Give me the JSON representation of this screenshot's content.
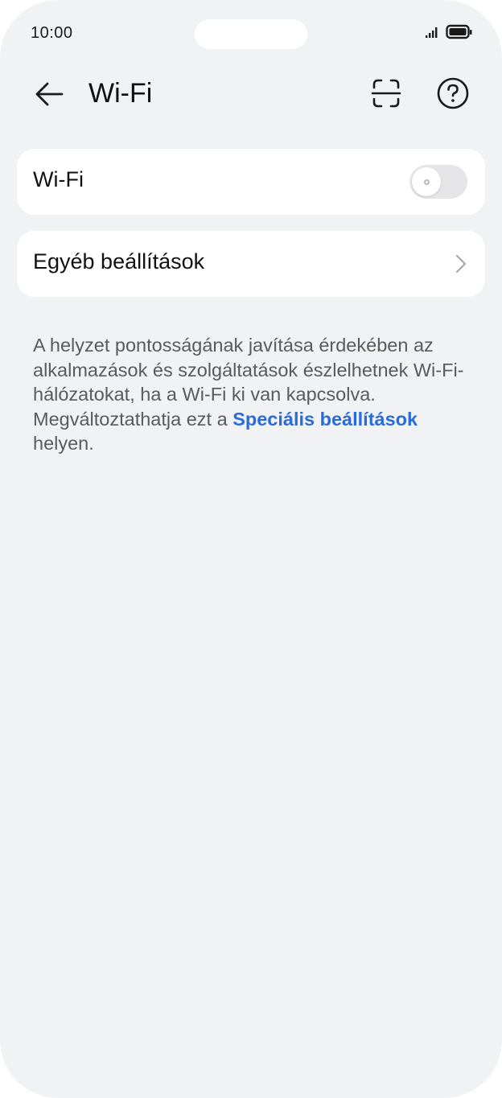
{
  "status_bar": {
    "time": "10:00",
    "icons": [
      "signal-icon",
      "battery-icon"
    ]
  },
  "header": {
    "title": "Wi-Fi",
    "back_icon": "back-arrow-icon",
    "scan_icon": "scan-qr-icon",
    "help_icon": "help-icon"
  },
  "settings": {
    "wifi": {
      "label": "Wi-Fi",
      "enabled": false
    },
    "other": {
      "label": "Egyéb beállítások",
      "icon": "chevron-right-icon"
    }
  },
  "info": {
    "text_before": "A helyzet pontosságának javítása érdekében az alkalmazások és szolgáltatások észlelhetnek Wi-Fi-hálózatokat, ha a Wi-Fi ki van kapcsolva. Megváltoztathatja ezt a ",
    "link": "Speciális beállítások",
    "text_after": " helyen."
  },
  "colors": {
    "background": "#f1f2f4",
    "card": "#ffffff",
    "link": "#2a6bdc",
    "toggle_off": "#e6e6e8"
  }
}
